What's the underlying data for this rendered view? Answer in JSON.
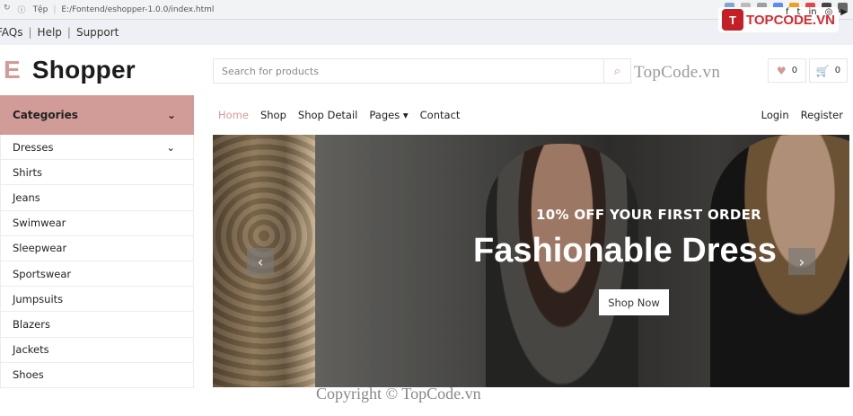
{
  "browser": {
    "url_prefix": "Tệp",
    "url_path": "E:/Fontend/eshopper-1.0.0/index.html"
  },
  "topbar": {
    "links": [
      "FAQs",
      "Help",
      "Support"
    ]
  },
  "watermark": {
    "brand": "TOPCODE.VN",
    "header_text": "TopCode.vn",
    "copyright": "Copyright © TopCode.vn"
  },
  "social_icons": [
    "facebook-icon",
    "twitter-icon",
    "linkedin-icon",
    "instagram-icon",
    "youtube-icon"
  ],
  "header": {
    "brand_letter": "E",
    "brand_name": "Shopper",
    "search_placeholder": "Search for products",
    "wishlist_count": "0",
    "cart_count": "0"
  },
  "categories": {
    "title": "Categories",
    "items": [
      "Dresses",
      "Shirts",
      "Jeans",
      "Swimwear",
      "Sleepwear",
      "Sportswear",
      "Jumpsuits",
      "Blazers",
      "Jackets",
      "Shoes"
    ]
  },
  "navbar": {
    "items": [
      "Home",
      "Shop",
      "Shop Detail",
      "Pages",
      "Contact"
    ],
    "right": [
      "Login",
      "Register"
    ]
  },
  "hero": {
    "subtitle": "10% OFF YOUR FIRST ORDER",
    "title": "Fashionable Dress",
    "cta": "Shop Now"
  },
  "colors": {
    "primary": "#d19c97",
    "dark": "#1c1c1c"
  }
}
